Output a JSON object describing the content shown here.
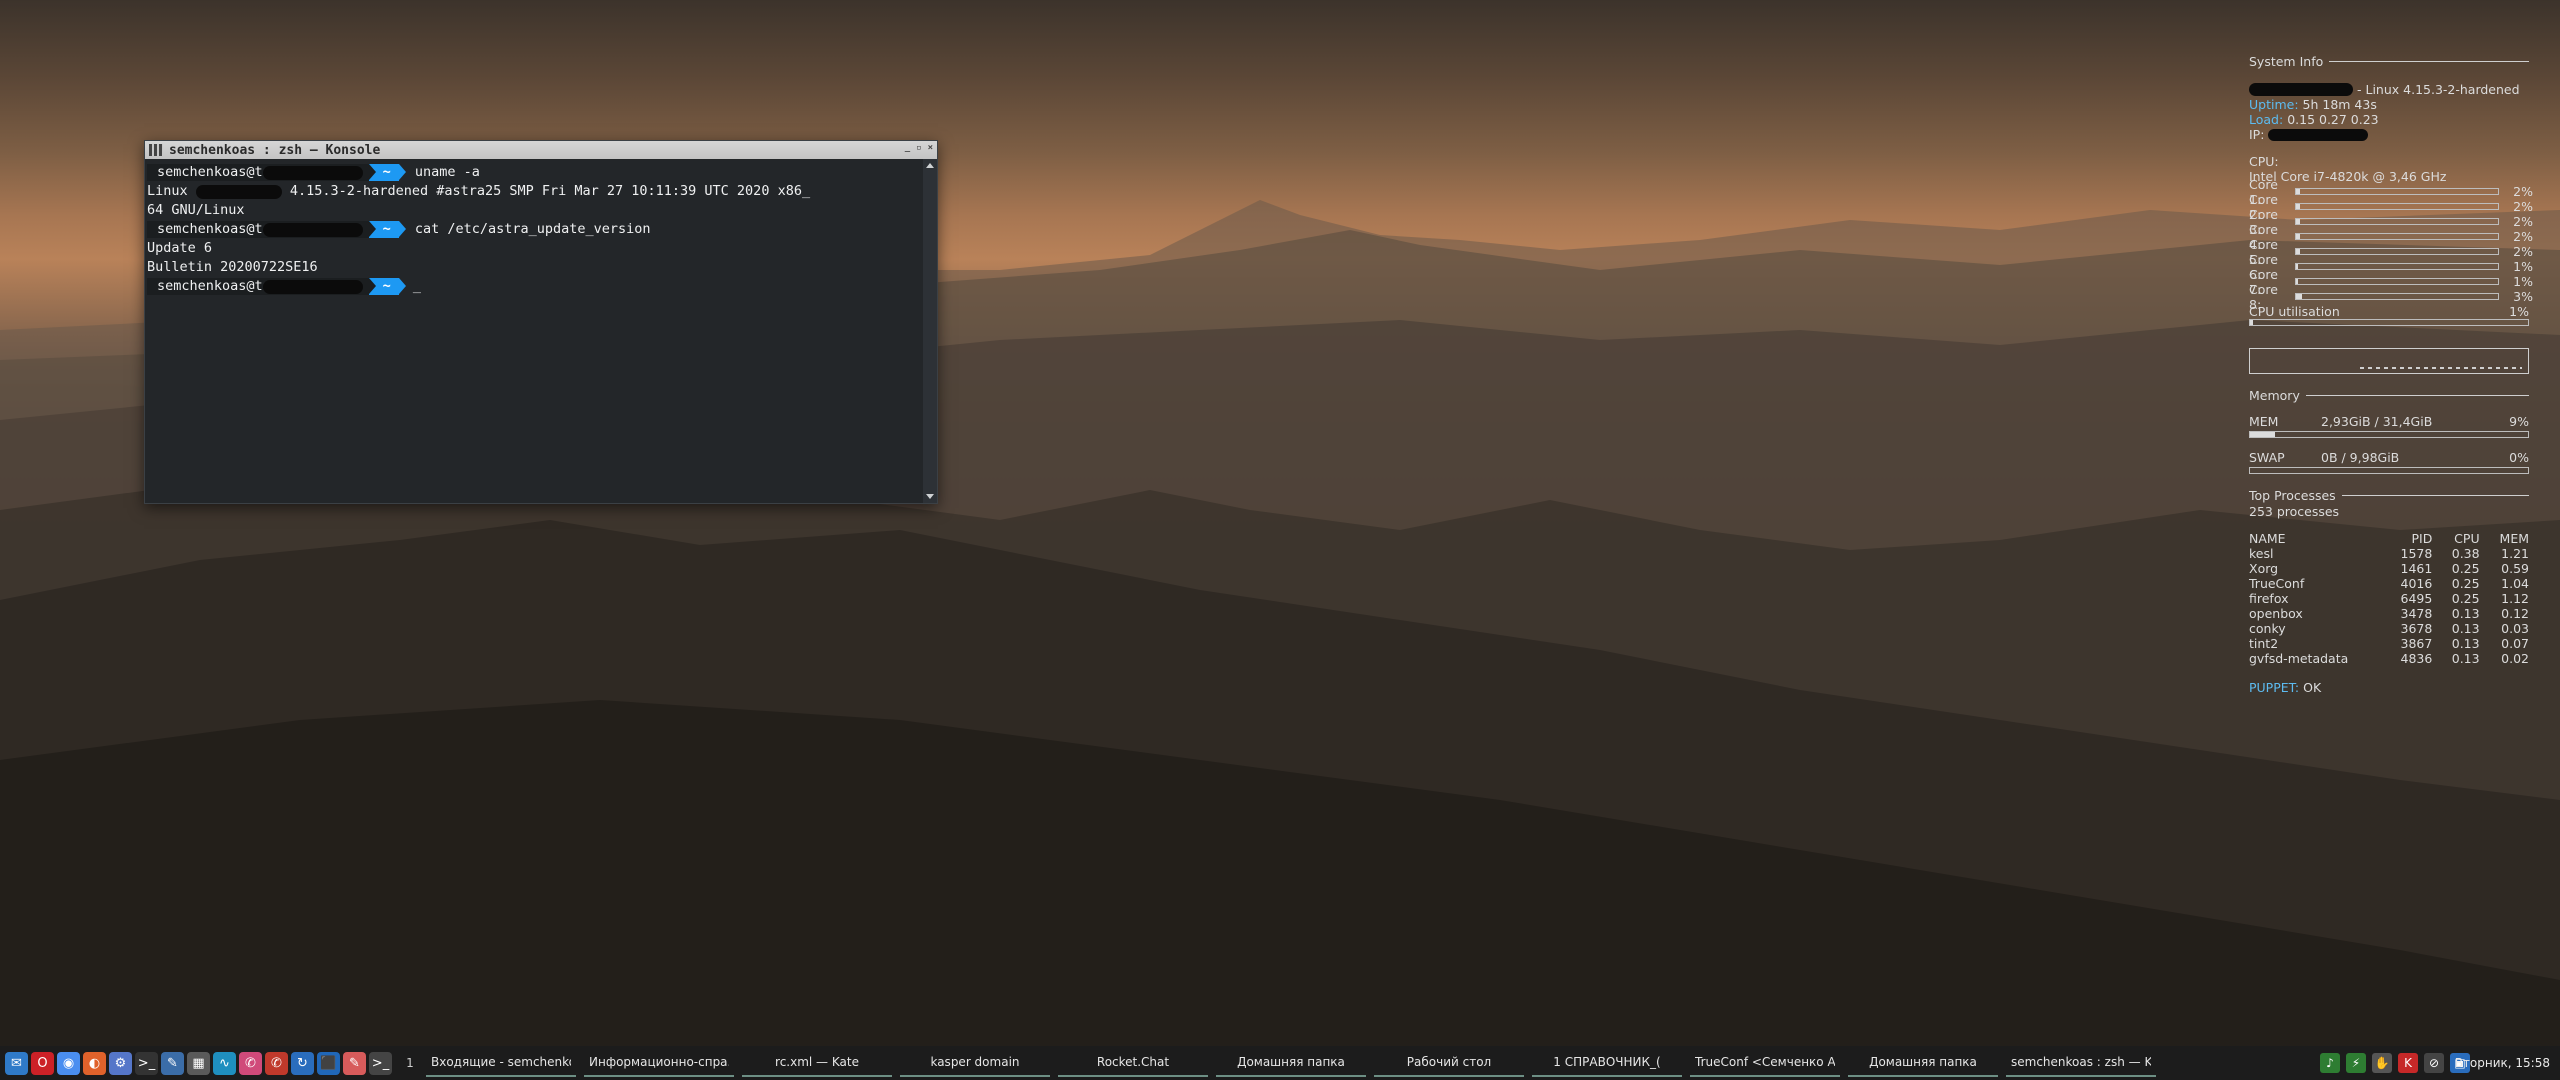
{
  "terminal": {
    "title": "semchenkoas : zsh — Konsole",
    "lines": [
      {
        "user": "semchenkoas@t",
        "command": "uname -a"
      },
      {
        "output": "Linux ",
        "output_cont": " 4.15.3-2-hardened #astra25 SMP Fri Mar 27 10:11:39 UTC 2020 x86_"
      },
      {
        "output": "64 GNU/Linux"
      },
      {
        "user": "semchenkoas@t",
        "command": "cat /etc/astra_update_version"
      },
      {
        "output": "Update 6"
      },
      {
        "output": "Bulletin 20200722SE16"
      },
      {
        "user": "semchenkoas@t",
        "command": "_"
      }
    ],
    "prompt_dir": "~"
  },
  "conky": {
    "system_title": "System Info",
    "kernel": "- Linux 4.15.3-2-hardened",
    "uptime_label": "Uptime:",
    "uptime_value": "5h 18m 43s",
    "load_label": "Load:",
    "load_value": "0.15 0.27 0.23",
    "ip_label": "IP:",
    "cpu_label": "CPU:",
    "cpu_model": "Intel Core i7-4820k @ 3,46 GHz",
    "cores": [
      {
        "label": "Core 1:",
        "pct": "2%",
        "level": 2
      },
      {
        "label": "Core 2:",
        "pct": "2%",
        "level": 2
      },
      {
        "label": "Core 3:",
        "pct": "2%",
        "level": 2
      },
      {
        "label": "Core 4:",
        "pct": "2%",
        "level": 2
      },
      {
        "label": "Core 5:",
        "pct": "2%",
        "level": 2
      },
      {
        "label": "Core 6:",
        "pct": "1%",
        "level": 1
      },
      {
        "label": "Core 7:",
        "pct": "1%",
        "level": 1
      },
      {
        "label": "Core 8:",
        "pct": "3%",
        "level": 3
      }
    ],
    "cpu_util_label": "CPU utilisation",
    "cpu_util_value": "1%",
    "cpu_util_level": 1,
    "memory_title": "Memory",
    "mem_label": "MEM",
    "mem_value": "2,93GiB / 31,4GiB",
    "mem_pct": "9%",
    "mem_level": 9,
    "swap_label": "SWAP",
    "swap_value": "0B   / 9,98GiB",
    "swap_pct": "0%",
    "swap_level": 0,
    "processes_title": "Top Processes",
    "processes_count": "253 processes",
    "proc_headers": [
      "NAME",
      "PID",
      "CPU",
      "MEM"
    ],
    "procs": [
      [
        "kesl",
        "1578",
        "0.38",
        "1.21"
      ],
      [
        "Xorg",
        "1461",
        "0.25",
        "0.59"
      ],
      [
        "TrueConf",
        "4016",
        "0.25",
        "1.04"
      ],
      [
        "firefox",
        "6495",
        "0.25",
        "1.12"
      ],
      [
        "openbox",
        "3478",
        "0.13",
        "0.12"
      ],
      [
        "conky",
        "3678",
        "0.13",
        "0.03"
      ],
      [
        "tint2",
        "3867",
        "0.13",
        "0.07"
      ],
      [
        "gvfsd-metadata",
        "4836",
        "0.13",
        "0.02"
      ]
    ],
    "puppet_label": "PUPPET:",
    "puppet_value": "OK"
  },
  "taskbar": {
    "desktop_number": "1",
    "tasks": [
      "Входящие - semchenko...",
      "Информационно-спра...",
      "rc.xml  — Kate",
      "kasper domain",
      "Rocket.Chat",
      "Домашняя папка",
      "Рабочий стол",
      "1 СПРАВОЧНИК_(",
      "TrueConf <Семченко А...",
      "Домашняя папка",
      "semchenkoas : zsh — K..."
    ],
    "clock": "Вторник, 15:58",
    "launcher_icons": [
      "thunderbird-icon",
      "opera-icon",
      "chrome-icon",
      "firefox-icon",
      "gear-icon",
      "terminal-icon",
      "editor-icon",
      "calculator-icon",
      "chart-icon",
      "chat-icon",
      "chat-icon",
      "update-icon",
      "virtualbox-icon",
      "notes-icon",
      "terminal-icon"
    ],
    "tray_icons": [
      "volume-icon",
      "network-icon",
      "security-icon",
      "antivirus-icon",
      "block-icon",
      "monitor-icon"
    ]
  }
}
